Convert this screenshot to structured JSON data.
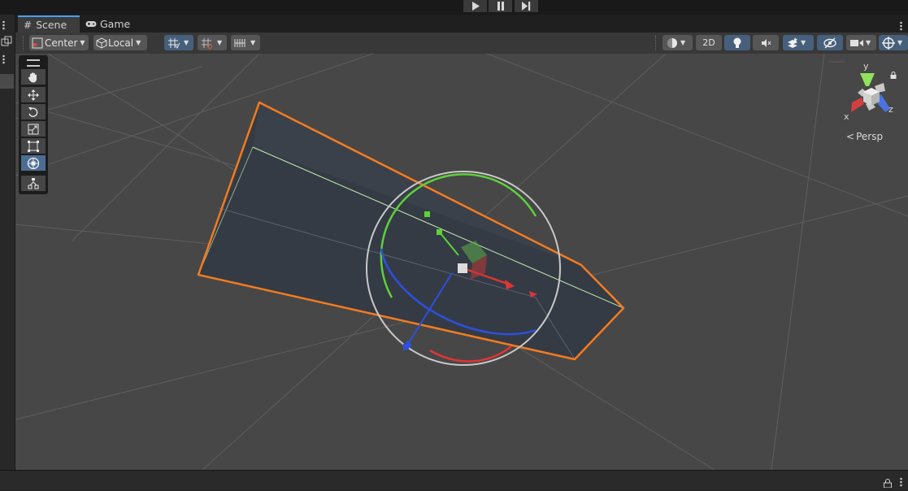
{
  "playbar": {
    "buttons": [
      "play-icon",
      "pause-icon",
      "step-icon"
    ]
  },
  "tabs": [
    {
      "label": "Scene",
      "icon": "grid-icon",
      "active": true
    },
    {
      "label": "Game",
      "icon": "gamepad-icon",
      "active": false
    }
  ],
  "toolbar": {
    "pivot_label": "Center",
    "space_label": "Local",
    "mode_2d_label": "2D"
  },
  "gizmo": {
    "axis_y": "y",
    "axis_x": "x",
    "axis_z": "z",
    "projection_label": "Persp"
  },
  "tools": [
    "view-tool-hand-icon",
    "move-tool-icon",
    "rotate-tool-icon",
    "scale-tool-icon",
    "rect-tool-icon",
    "transform-tool-icon",
    "custom-tool-icon"
  ],
  "colors": {
    "selection_outline": "#f47b1f",
    "axis_x": "#e03535",
    "axis_y": "#5ed13a",
    "axis_z": "#2d50e0",
    "active_button": "#46607c",
    "viewport_bg": "#474747"
  }
}
